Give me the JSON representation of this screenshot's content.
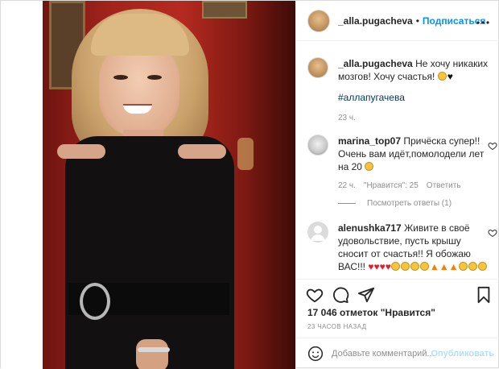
{
  "header": {
    "username": "_alla.pugacheva",
    "separator": "•",
    "follow_label": "Подписаться",
    "more_icon": "more-horizontal-icon"
  },
  "caption": {
    "username": "_alla.pugacheva",
    "text": "Не хочу никаких мозгов! Хочу счастья!",
    "hashtag": "#аллапугачева",
    "time": "23 ч."
  },
  "comments": [
    {
      "username": "marina_top07",
      "text": "Причёска супер!! Очень вам идёт,помолодели лет на 20",
      "time": "22 ч.",
      "likes": "\"Нравится\": 25",
      "reply": "Ответить"
    },
    {
      "username": "alenushka717",
      "text": "Живите в своё удовольствие, пусть крышу сносит от счастья!! Я обожаю ВАС!!!"
    }
  ],
  "view_replies": "Посмотреть ответы (1)",
  "actions": {
    "like_icon": "heart-icon",
    "comment_icon": "comment-icon",
    "share_icon": "share-icon",
    "save_icon": "bookmark-icon"
  },
  "likes_count": "17 046 отметок \"Нравится\"",
  "timestamp": "23 ЧАСОВ НАЗАД",
  "add_comment": {
    "placeholder": "Добавьте комментарий...",
    "publish_label": "Опубликовать"
  },
  "colors": {
    "link_blue": "#0095f6",
    "hashtag": "#00376b",
    "muted": "#8e8e8e"
  }
}
